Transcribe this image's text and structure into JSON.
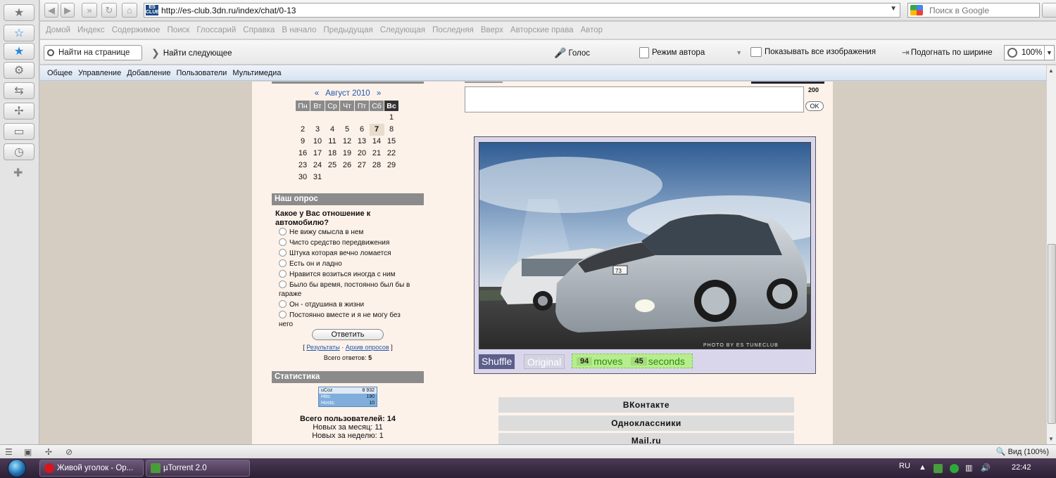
{
  "browser": {
    "url": "http://es-club.3dn.ru/index/chat/0-13",
    "search_placeholder": "Поиск в Google",
    "favicon_label": "ES CLUB",
    "link_bar": [
      "Домой",
      "Индекс",
      "Содержимое",
      "Поиск",
      "Глоссарий",
      "Справка",
      "В начало",
      "Предыдущая",
      "Следующая",
      "Последняя",
      "Вверх",
      "Авторские права",
      "Автор"
    ],
    "find": {
      "input_placeholder": "Найти на странице",
      "find_next": "Найти следующее",
      "voice": "Голос",
      "author_mode": "Режим автора",
      "show_images": "Показывать все изображения",
      "fit_width": "Подогнать по ширине",
      "zoom": "100%"
    },
    "menu_bar": [
      "Общее",
      "Управление",
      "Добавление",
      "Пользователи",
      "Мультимедиа"
    ],
    "status_zoom": "Вид (100%)"
  },
  "calendar": {
    "prev": "«",
    "month": "Август 2010",
    "next": "»",
    "weekdays": [
      "Пн",
      "Вт",
      "Ср",
      "Чт",
      "Пт",
      "Сб",
      "Вс"
    ],
    "weeks": [
      [
        "",
        "",
        "",
        "",
        "",
        "",
        "1"
      ],
      [
        "2",
        "3",
        "4",
        "5",
        "6",
        "7",
        "8"
      ],
      [
        "9",
        "10",
        "11",
        "12",
        "13",
        "14",
        "15"
      ],
      [
        "16",
        "17",
        "18",
        "19",
        "20",
        "21",
        "22"
      ],
      [
        "23",
        "24",
        "25",
        "26",
        "27",
        "28",
        "29"
      ],
      [
        "30",
        "31",
        "",
        "",
        "",
        "",
        ""
      ]
    ],
    "today": "7"
  },
  "poll": {
    "header": "Наш опрос",
    "question": "Какое у Вас отношение к автомобилю?",
    "options": [
      "Не вижу смысла в нем",
      "Чисто средство передвижения",
      "Штука которая вечно ломается",
      "Есть он и ладно",
      "Нравится возиться иногда с ним",
      "Было бы время, постоянно был бы в гараже",
      "Он - отдушина в жизни",
      "Постоянно вместе и я не могу без него"
    ],
    "vote_button": "Ответить",
    "results_link": "Результаты",
    "archive_link": "Архив опросов",
    "total_label": "Всего ответов:",
    "total_value": "5"
  },
  "stats": {
    "header": "Статистика",
    "counter": {
      "logo": "uCoz",
      "top": "8 932",
      "hits_label": "Hits:",
      "hits": "190",
      "hosts_label": "Hosts:",
      "hosts": "10"
    },
    "total_users": "Всего пользователей: 14",
    "new_month": "Новых за месяц: 11",
    "new_week": "Новых за неделю: 1"
  },
  "chat": {
    "char_limit": "200",
    "ok_button": "OK"
  },
  "puzzle": {
    "photo_credit": "PHOTO BY ES TUNECLUB",
    "plate": "73",
    "shuffle_button": "Shuffle",
    "original_button": "Original",
    "moves_value": "94",
    "moves_label": "moves",
    "seconds_value": "45",
    "seconds_label": "seconds"
  },
  "social": [
    "ВКонтакте",
    "Одноклассники",
    "Mail.ru"
  ],
  "taskbar": {
    "tasks": [
      "Живой уголок - Ор...",
      "µTorrent 2.0"
    ],
    "lang": "RU",
    "time": "22:42"
  }
}
